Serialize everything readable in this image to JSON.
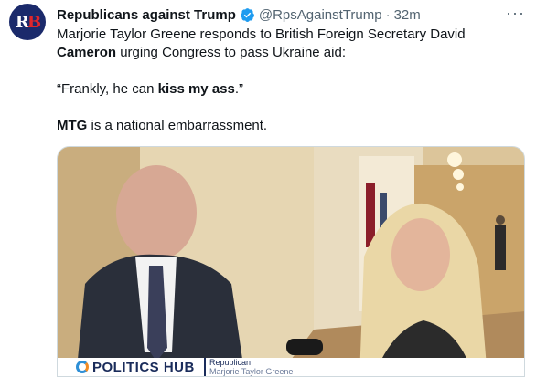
{
  "author": {
    "name": "Republicans against Trump",
    "handle": "@RpsAgainstTrump",
    "separator": "·",
    "time": "32m",
    "avatar_text_r": "R",
    "avatar_text_b": "B"
  },
  "menu_label": "···",
  "tweet": {
    "line1_pre": "Marjorie Taylor Greene responds to British Foreign Secretary David ",
    "line1_bold": "Cameron",
    "line1_post": " urging Congress to pass Ukraine aid:",
    "quote_pre": "“Frankly, he can ",
    "quote_bold": "kiss my ass",
    "quote_post": ".”",
    "last_bold": "MTG",
    "last_post": " is a national embarrassment."
  },
  "video": {
    "brand": "POLITICS HUB",
    "caption_top": "Republican",
    "caption_bottom": "Marjorie Taylor Greene"
  },
  "colors": {
    "verified": "#1d9bf0",
    "muted": "#536471",
    "text": "#0f1419"
  }
}
